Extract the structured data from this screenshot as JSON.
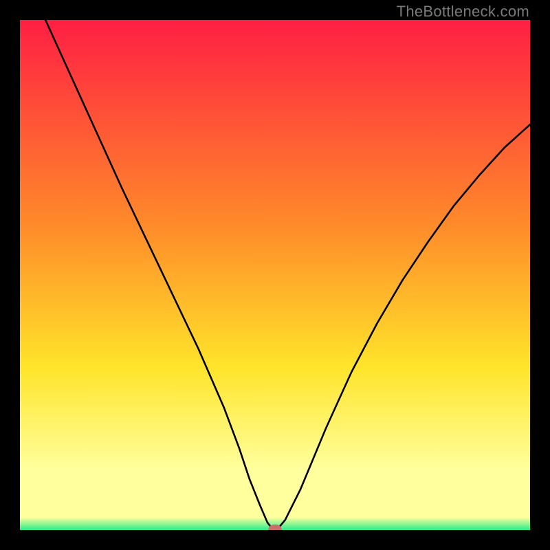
{
  "watermark": "TheBottleneck.com",
  "colors": {
    "red": "#ff1f43",
    "orange": "#ff8a2a",
    "yellow": "#ffe42a",
    "paleyellow": "#ffff9d",
    "green": "#26ed8a",
    "curve": "#000000",
    "marker": "#c76f68"
  },
  "chart_data": {
    "type": "line",
    "title": "",
    "xlabel": "",
    "ylabel": "",
    "xlim": [
      0,
      100
    ],
    "ylim": [
      0,
      100
    ],
    "gradient_bands": [
      {
        "name": "red-top",
        "start_pct": 0,
        "end_pct": 40
      },
      {
        "name": "orange",
        "start_pct": 40,
        "end_pct": 68
      },
      {
        "name": "yellow",
        "start_pct": 68,
        "end_pct": 88
      },
      {
        "name": "paleyellow",
        "start_pct": 88,
        "end_pct": 97
      },
      {
        "name": "green",
        "start_pct": 97,
        "end_pct": 100
      }
    ],
    "series": [
      {
        "name": "bottleneck-curve",
        "x": [
          5,
          10,
          15,
          20,
          25,
          30,
          35,
          40,
          43,
          45,
          47,
          48.5,
          49.5,
          50.5,
          52,
          55,
          60,
          65,
          70,
          75,
          80,
          85,
          90,
          95,
          100
        ],
        "y": [
          100,
          89,
          78,
          67,
          56.5,
          46,
          35.5,
          24,
          16,
          10,
          5,
          1.5,
          0.2,
          0.2,
          2,
          8,
          20,
          31,
          40.5,
          49,
          56.5,
          63.5,
          69.5,
          75,
          79.5
        ]
      }
    ],
    "marker": {
      "x": 50,
      "y": 0.2,
      "rx": 1.3,
      "ry": 0.9
    }
  }
}
